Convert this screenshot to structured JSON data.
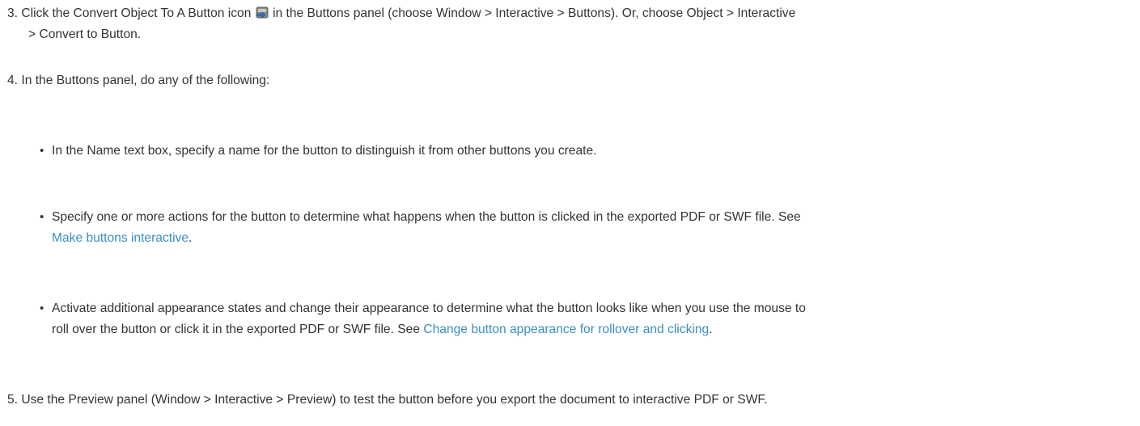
{
  "steps": {
    "s3": {
      "num": "3.",
      "before_icon": "Click the Convert Object To A Button icon",
      "icon": "convert-to-button-icon",
      "after_icon_line1": "in the Buttons panel (choose Window > Interactive > Buttons). Or, choose Object > Interactive",
      "line2": "> Convert to Button."
    },
    "s4": {
      "num": "4.",
      "text": "In the Buttons panel, do any of the following:"
    },
    "s5": {
      "num": "5.",
      "text": "Use the Preview panel (Window > Interactive > Preview) to test the button before you export the document to interactive PDF or SWF."
    }
  },
  "bullets": {
    "b1": {
      "text": "In the Name text box, specify a name for the button to distinguish it from other buttons you create."
    },
    "b2": {
      "line1": "Specify one or more actions for the button to determine what happens when the button is clicked in the exported PDF or SWF file. See",
      "link": "Make buttons interactive",
      "after_link": "."
    },
    "b3": {
      "line1": "Activate additional appearance states and change their appearance to determine what the button looks like when you use the mouse to",
      "line2_before": "roll over the button or click it in the exported PDF or SWF file. See",
      "link": "Change button appearance for rollover and clicking",
      "after_link": "."
    }
  },
  "colors": {
    "text": "#333333",
    "link": "#3a8ec4"
  }
}
